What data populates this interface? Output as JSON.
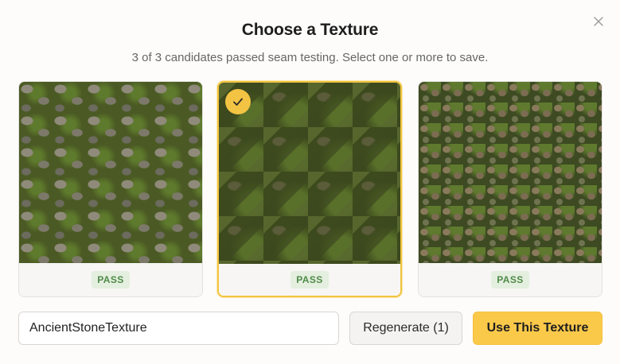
{
  "dialog": {
    "title": "Choose a Texture",
    "subtitle": "3 of 3 candidates passed seam testing. Select one or more to save.",
    "close_icon": "close-icon"
  },
  "candidates": [
    {
      "status": "PASS",
      "selected": false,
      "texture": "mossy cobblestone, large rounded stones"
    },
    {
      "status": "PASS",
      "selected": true,
      "texture": "dark mossy ground with scattered stones"
    },
    {
      "status": "PASS",
      "selected": false,
      "texture": "small brick-like stones with moss"
    }
  ],
  "form": {
    "name_value": "AncientStoneTexture",
    "regenerate_label": "Regenerate (1)",
    "use_label": "Use This Texture"
  },
  "colors": {
    "accent": "#fbc94a",
    "selected_border": "#f2c440",
    "pass_text": "#4f8a49",
    "pass_bg": "#e4efdf"
  }
}
